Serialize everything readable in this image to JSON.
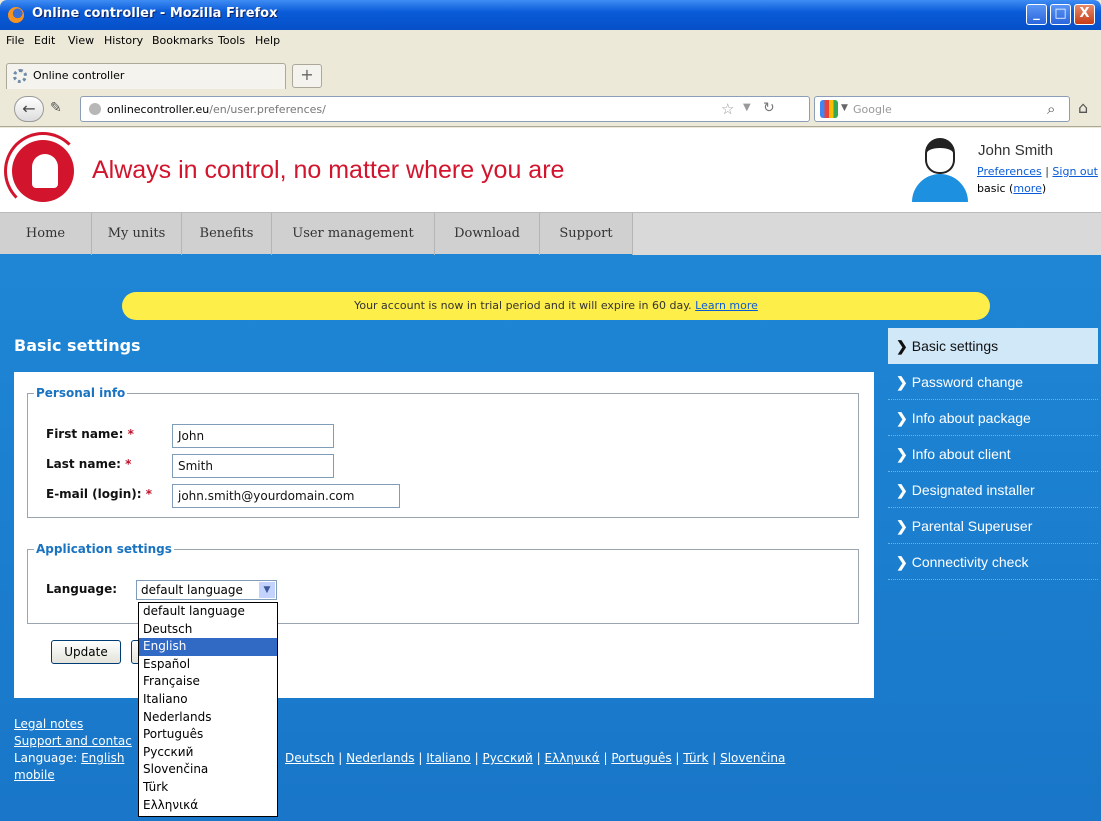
{
  "window": {
    "title": "Online controller - Mozilla Firefox",
    "min": "_",
    "max": "□",
    "close": "X"
  },
  "menu": [
    "File",
    "Edit",
    "View",
    "History",
    "Bookmarks",
    "Tools",
    "Help"
  ],
  "tab": {
    "label": "Online controller",
    "new_tab": "+"
  },
  "nav": {
    "url_domain": "onlinecontroller.eu",
    "url_path": "/en/user.preferences/",
    "search_engine": "Google",
    "back": "←"
  },
  "header": {
    "slogan": "Always in control, no matter where you are",
    "user_name": "John Smith",
    "preferences": "Preferences",
    "separator": "|",
    "sign_out": "Sign out",
    "plan": "basic",
    "more": "more"
  },
  "main_nav": [
    "Home",
    "My units",
    "Benefits",
    "User management",
    "Download",
    "Support"
  ],
  "notice": {
    "text": "Your account is now in trial period and it will expire in 60 day.",
    "link": "Learn more"
  },
  "page_title": "Basic settings",
  "personal_info": {
    "legend": "Personal info",
    "first_name_label": "First name:",
    "first_name": "John",
    "last_name_label": "Last name:",
    "last_name": "Smith",
    "email_label": "E-mail (login):",
    "email": "john.smith@yourdomain.com",
    "required_mark": "*"
  },
  "app_settings": {
    "legend": "Application settings",
    "language_label": "Language:",
    "language_value": "default language",
    "options": [
      "default language",
      "Deutsch",
      "English",
      "Español",
      "Française",
      "Italiano",
      "Nederlands",
      "Português",
      "Русский",
      "Slovenčina",
      "Türk",
      "Ελληνικά"
    ],
    "highlighted": "English"
  },
  "buttons": {
    "update": "Update"
  },
  "sidebar": [
    "Basic settings",
    "Password change",
    "Info about package",
    "Info about client",
    "Designated installer",
    "Parental Superuser",
    "Connectivity check"
  ],
  "footer": {
    "legal": "Legal notes",
    "support": "Support and contac",
    "language_prefix": "Language:",
    "current_language": "English",
    "mobile": "mobile",
    "languages": [
      "Deutsch",
      "Nederlands",
      "Italiano",
      "Русский",
      "Ελληνικά",
      "Português",
      "Türk",
      "Slovenčina"
    ]
  },
  "colors": {
    "brand_red": "#d2142c",
    "page_blue": "#1f8ad8",
    "notice_yellow": "#fdee4a",
    "selection_blue": "#316ac5"
  }
}
